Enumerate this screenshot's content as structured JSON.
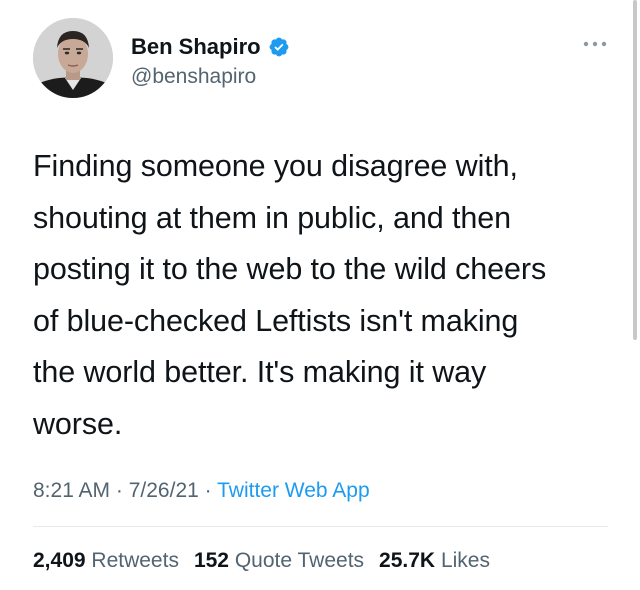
{
  "tweet": {
    "author": {
      "display_name": "Ben Shapiro",
      "handle": "@benshapiro",
      "verified_icon": "verified-badge-icon",
      "badge_color": "#1d9bf0"
    },
    "text": "Finding someone you disagree with,\nshouting at them in public, and then\nposting it to the web to the wild cheers\nof blue-checked Leftists isn't making\nthe world better. It's making it way\nworse.",
    "time": "8:21 AM",
    "date": "7/26/21",
    "separator": " · ",
    "source": "Twitter Web App",
    "stats": {
      "retweets_count": "2,409",
      "retweets_label": "Retweets",
      "quotes_count": "152",
      "quotes_label": "Quote Tweets",
      "likes_count": "25.7K",
      "likes_label": "Likes"
    }
  },
  "colors": {
    "text": "#0f1419",
    "secondary": "#536471",
    "link": "#1d9bf0",
    "divider": "#e7e9ea"
  }
}
